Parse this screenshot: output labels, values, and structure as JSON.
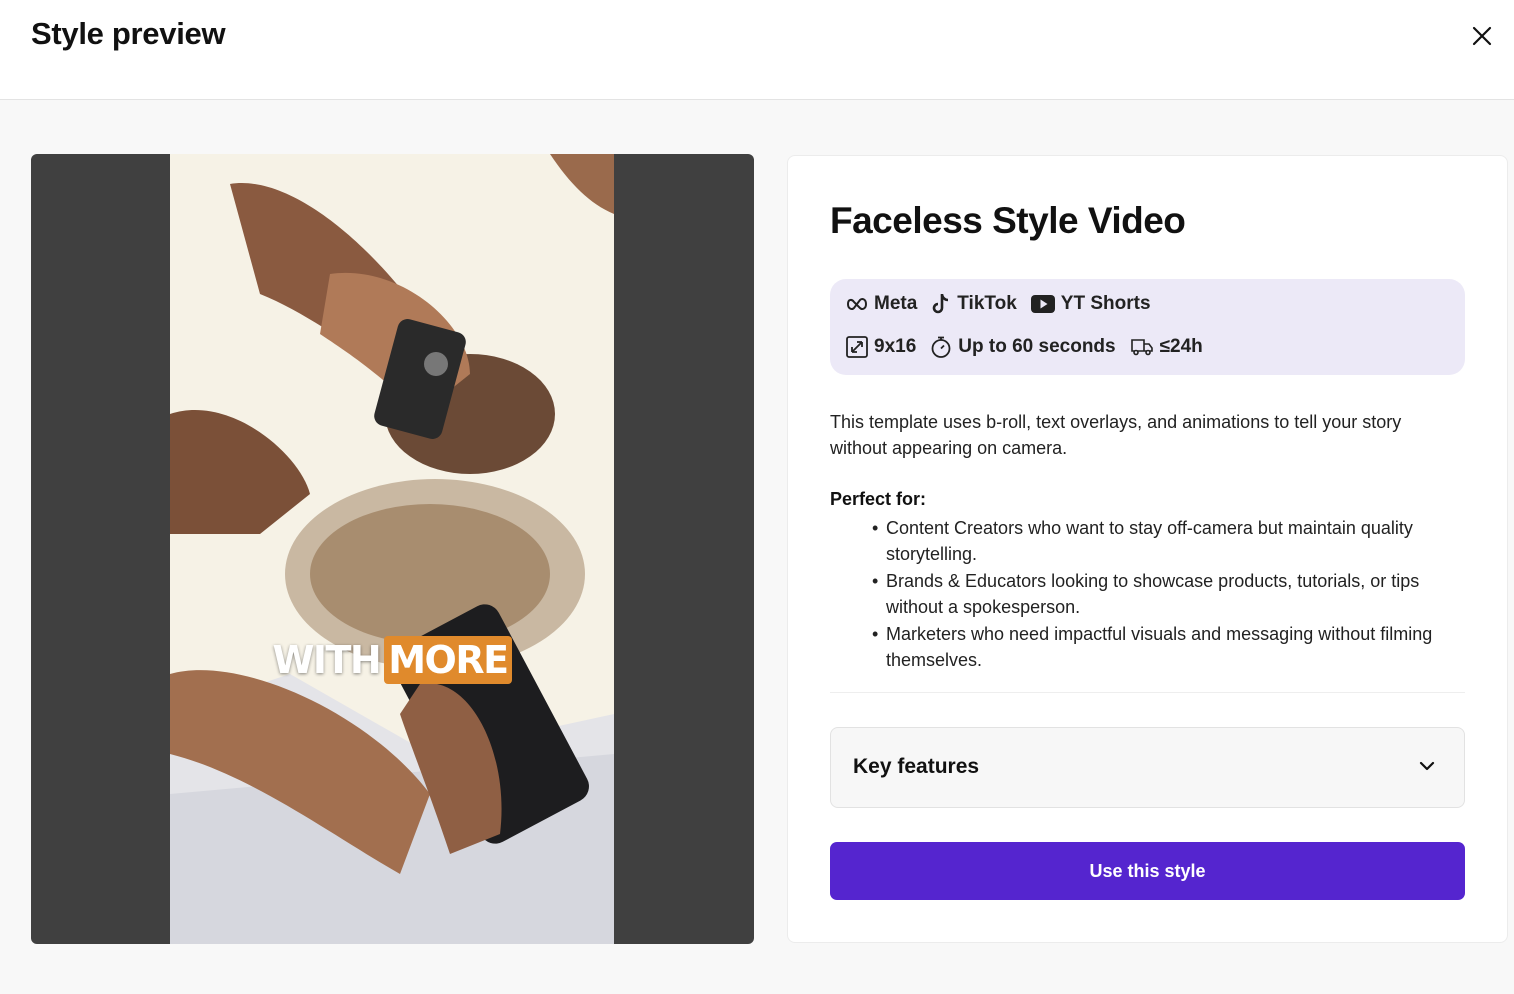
{
  "header": {
    "title": "Style preview",
    "close_icon": "close-icon"
  },
  "preview": {
    "caption_white": "WITH",
    "caption_highlight": "MORE",
    "caption_highlight_color": "#e08a2c"
  },
  "details": {
    "title": "Faceless Style Video",
    "platforms": [
      {
        "icon": "meta-icon",
        "label": "Meta"
      },
      {
        "icon": "tiktok-icon",
        "label": "TikTok"
      },
      {
        "icon": "youtube-icon",
        "label": "YT Shorts"
      }
    ],
    "specs": [
      {
        "icon": "resize-icon",
        "label": "9x16"
      },
      {
        "icon": "stopwatch-icon",
        "label": "Up to 60 seconds"
      },
      {
        "icon": "delivery-truck-icon",
        "label": "≤24h"
      }
    ],
    "description": "This template uses b-roll, text overlays, and animations to tell your story without appearing on camera.",
    "perfect_for_heading": "Perfect for:",
    "perfect_for": [
      "Content Creators who want to stay off-camera but maintain quality storytelling.",
      "Brands & Educators looking to showcase products, tutorials, or tips without a spokesperson.",
      "Marketers who need impactful visuals and messaging without filming themselves."
    ],
    "accordion_label": "Key features",
    "cta_label": "Use this style",
    "accent_color": "#5525cf",
    "tag_background": "#ece9f7"
  }
}
